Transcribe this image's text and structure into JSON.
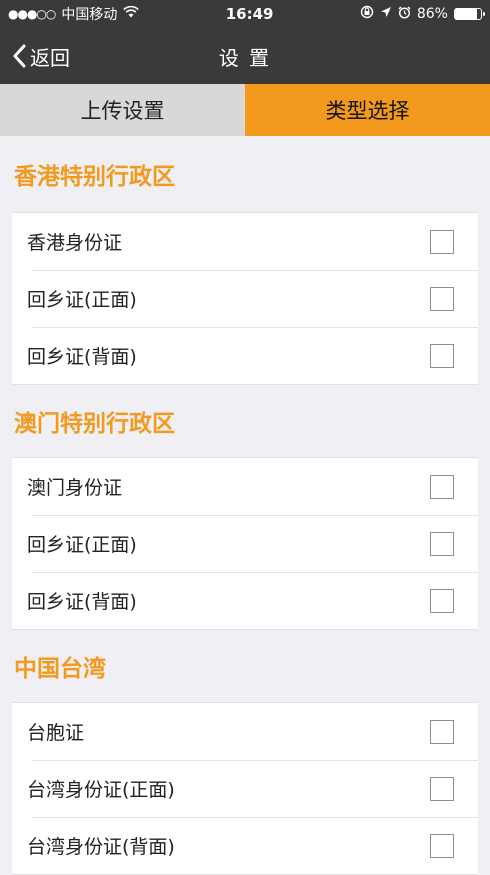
{
  "status_bar": {
    "carrier": "中国移动",
    "time": "16:49",
    "battery_text": "86%",
    "battery_level": 0.86,
    "icons": [
      "signal-icon",
      "wifi-icon",
      "lock-rotation-icon",
      "location-icon",
      "alarm-icon",
      "battery-icon"
    ]
  },
  "nav": {
    "back_label": "返回",
    "title": "设 置"
  },
  "tabs": [
    {
      "label": "上传设置",
      "active": false
    },
    {
      "label": "类型选择",
      "active": true
    }
  ],
  "colors": {
    "accent": "#f39a1e",
    "nav_background": "#3a3a3a",
    "page_background": "#efeff4"
  },
  "sections": [
    {
      "title": "香港特别行政区",
      "items": [
        {
          "label": "香港身份证",
          "checked": false
        },
        {
          "label": "回乡证(正面)",
          "checked": false
        },
        {
          "label": "回乡证(背面)",
          "checked": false
        }
      ]
    },
    {
      "title": "澳门特别行政区",
      "items": [
        {
          "label": "澳门身份证",
          "checked": false
        },
        {
          "label": "回乡证(正面)",
          "checked": false
        },
        {
          "label": "回乡证(背面)",
          "checked": false
        }
      ]
    },
    {
      "title": "中国台湾",
      "items": [
        {
          "label": "台胞证",
          "checked": false
        },
        {
          "label": "台湾身份证(正面)",
          "checked": false
        },
        {
          "label": "台湾身份证(背面)",
          "checked": false
        }
      ]
    }
  ]
}
